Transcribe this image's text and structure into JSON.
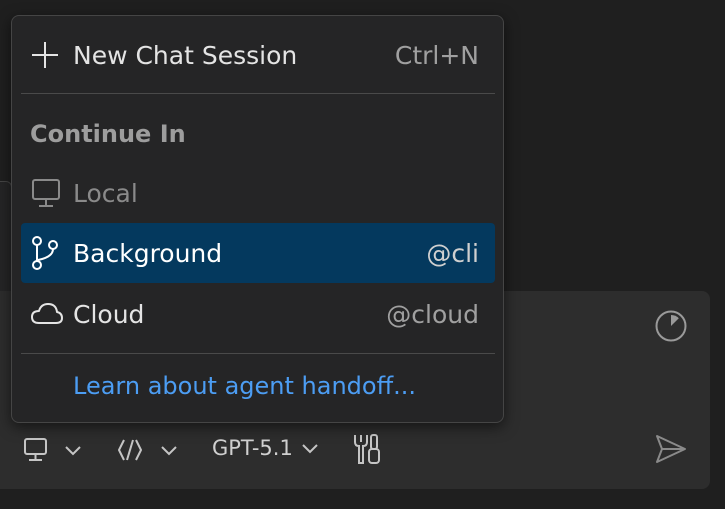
{
  "menu": {
    "new_session": {
      "label": "New Chat Session",
      "shortcut": "Ctrl+N",
      "icon": "plus-icon"
    },
    "section_header": "Continue In",
    "items": [
      {
        "label": "Local",
        "shortcut": "",
        "icon": "monitor-icon",
        "state": "disabled"
      },
      {
        "label": "Background",
        "shortcut": "@cli",
        "icon": "git-branch-icon",
        "state": "selected"
      },
      {
        "label": "Cloud",
        "shortcut": "@cloud",
        "icon": "cloud-icon",
        "state": "normal"
      }
    ],
    "link": "Learn about agent handoff..."
  },
  "toolbar": {
    "model": "GPT-5.1",
    "icons": [
      "monitor-icon",
      "chevron-down-icon",
      "agent-mode-icon",
      "chevron-down-icon",
      "chevron-down-icon",
      "tools-icon",
      "context-progress-icon",
      "send-icon"
    ]
  },
  "colors": {
    "selected_bg": "#04395e",
    "link": "#4c9df3",
    "menu_bg": "#252526",
    "panel_bg": "#2d2d2d"
  }
}
